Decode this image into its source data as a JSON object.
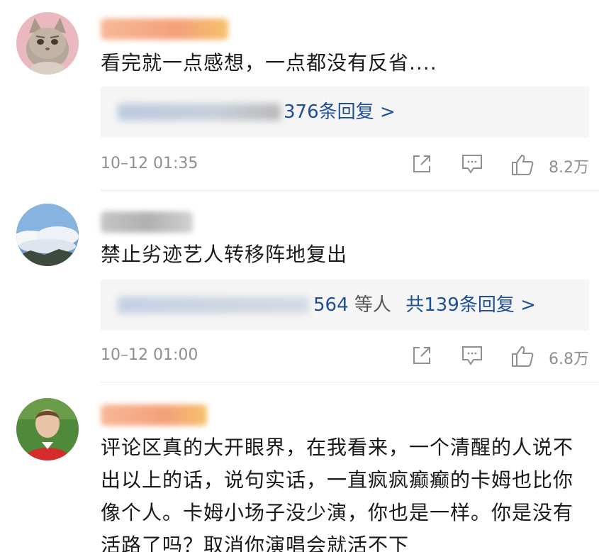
{
  "comments": [
    {
      "text": "看完就一点感想，一点都没有反省....",
      "reply_summary": "376条回复 >",
      "timestamp": "10–12 01:35",
      "likes": "8.2万",
      "avatar_icon": "cat-avatar",
      "name_color": "#f4a07a"
    },
    {
      "text": "禁止劣迹艺人转移阵地复出",
      "reply_count_visible": "564",
      "reply_people": "等人",
      "reply_summary": "共139条回复 >",
      "timestamp": "10–12 01:00",
      "likes": "6.8万",
      "avatar_icon": "sky-landscape-avatar",
      "name_color": "#b8b8b8"
    },
    {
      "text": "评论区真的大开眼界，在我看来，一个清醒的人说不出以上的话，说句实话，一直疯疯癫癫的卡姆也比你像个人。卡姆小场子没少演，你也是一样。你是没有活路了吗？取消你演唱会就活不下",
      "avatar_icon": "person-avatar",
      "name_color": "#f4a07a"
    }
  ],
  "colors": {
    "link_blue": "#1f4e9a",
    "meta_grey": "#8f8f8f",
    "reply_bg": "#f5f5f5"
  },
  "icons": [
    "share-icon",
    "comment-icon",
    "like-icon"
  ]
}
